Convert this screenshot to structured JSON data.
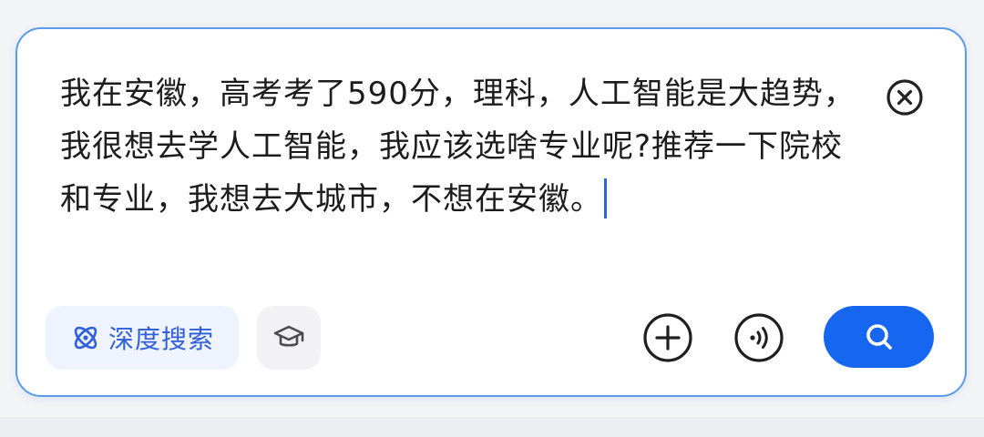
{
  "query": {
    "text": "我在安徽，高考考了590分，理科，人工智能是大趋势，我很想去学人工智能，我应该选啥专业呢?推荐一下院校和专业，我想去大城市，不想在安徽。"
  },
  "toolbar": {
    "deep_search_label": "深度搜索"
  },
  "icons": {
    "clear": "clear-circle-x-icon",
    "deep_search": "atom-icon",
    "education": "graduation-cap-icon",
    "add": "plus-circle-icon",
    "voice": "voice-wave-icon",
    "search": "search-icon"
  },
  "colors": {
    "accent": "#1766f0",
    "border": "#5a9bea",
    "deep_search_text": "#2f5fd9",
    "deep_search_bg": "#eef3fd",
    "text": "#1c1c1e"
  }
}
